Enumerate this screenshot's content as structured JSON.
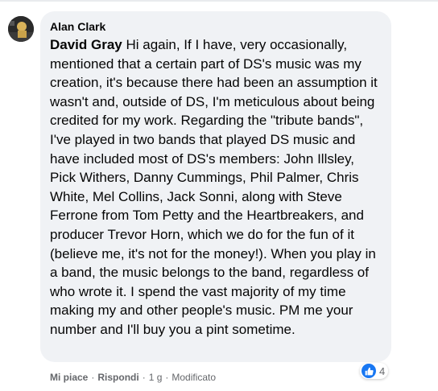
{
  "comment": {
    "author": "Alan Clark",
    "mention": "David Gray",
    "body": " Hi again, If I have, very occasionally, mentioned that a certain part of DS's music was my creation, it's because there had been an assumption it wasn't and, outside of DS, I'm meticulous about being credited for my work. Regarding the \"tribute bands\", I've played in two bands that played DS music and have included most of DS's members: John Illsley, Pick Withers, Danny Cummings, Phil Palmer, Chris White, Mel Collins, Jack Sonni, along with Steve Ferrone from Tom Petty and the Heartbreakers, and producer Trevor Horn, which we do for the fun of it (believe me, it's not for the money!). When you play in a band, the music belongs to the band, regardless of who wrote it. I spend the vast majority of my time making my and other people's music. PM me your number and I'll buy you a pint sometime.",
    "reactions": {
      "icon": "like-icon",
      "count": "4",
      "color": "#1877f2"
    }
  },
  "actions": {
    "like": "Mi piace",
    "reply": "Rispondi",
    "separator": "·",
    "time": "1 g",
    "edited": "Modificato"
  },
  "colors": {
    "bubble": "#f0f2f5",
    "text": "#050505",
    "secondary_text": "#65676b"
  }
}
